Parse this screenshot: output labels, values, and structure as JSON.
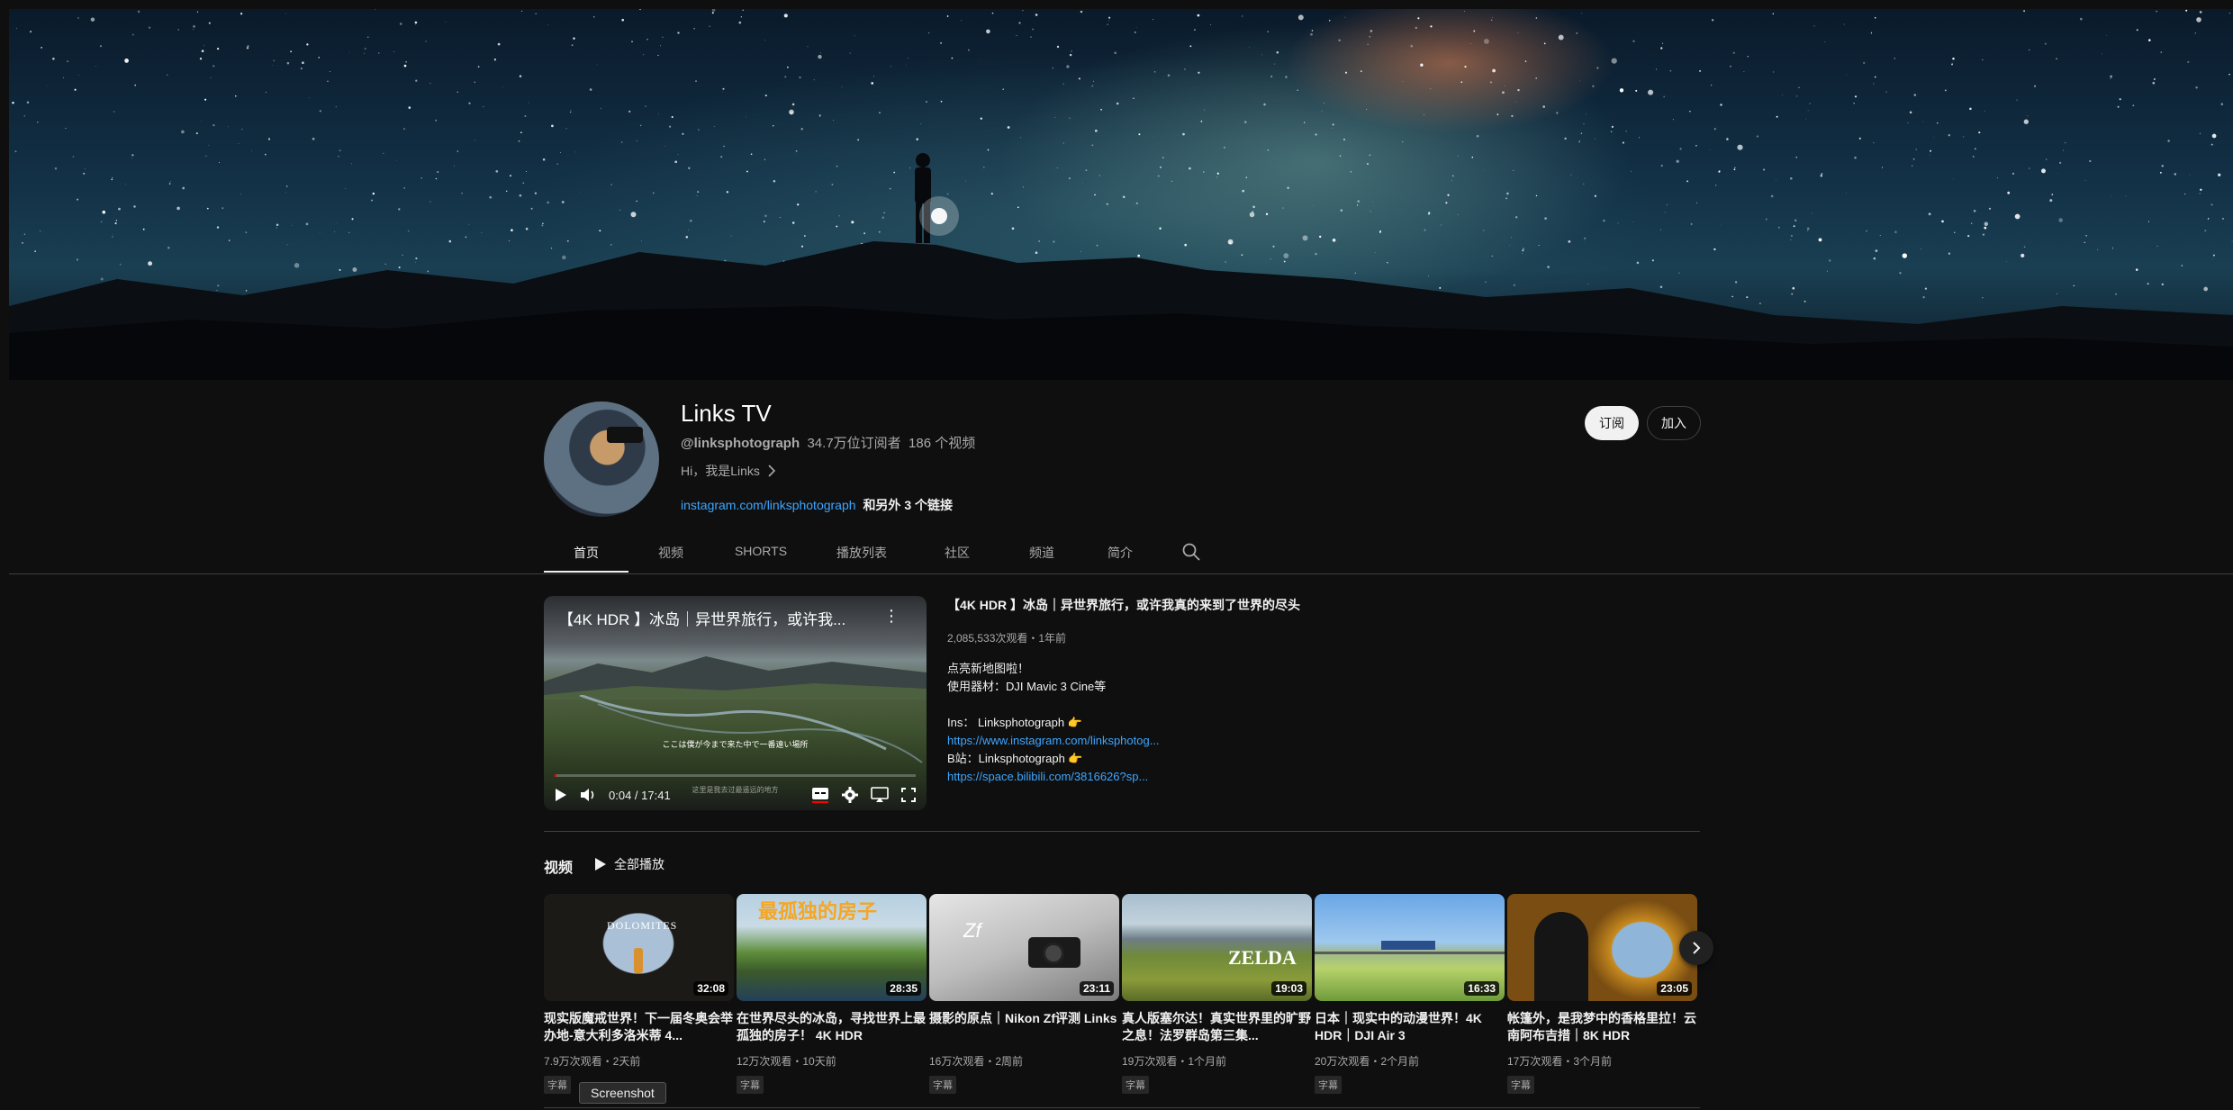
{
  "channel": {
    "name": "Links TV",
    "handle": "@linksphotograph",
    "subscribers": "34.7万位订阅者",
    "video_count": "186 个视频",
    "description": "Hi，我是Links",
    "link": "instagram.com/linksphotograph",
    "more_links": "和另外 3 个链接",
    "subscribe_label": "订阅",
    "join_label": "加入"
  },
  "tabs": [
    {
      "label": "首页"
    },
    {
      "label": "视频"
    },
    {
      "label": "SHORTS"
    },
    {
      "label": "播放列表"
    },
    {
      "label": "社区"
    },
    {
      "label": "频道"
    },
    {
      "label": "简介"
    }
  ],
  "featured": {
    "overlay_title": "【4K HDR 】冰岛｜异世界旅行，或许我...",
    "title": "【4K HDR 】冰岛｜异世界旅行，或许我真的来到了世界的尽头",
    "stats": "2,085,533次观看・1年前",
    "subtitle_line": "ここは僕が今まで来た中で一番遠い場所",
    "subtitle_line2": "这里是我去过最遥远的地方",
    "time": "0:04 / 17:41",
    "progress": 0.004,
    "desc": {
      "l1": "点亮新地图啦！",
      "l2": "使用器材：DJI Mavic 3 Cine等",
      "l3": "Ins： Linksphotograph 👉",
      "l4": "https://www.instagram.com/linksphotog...",
      "l5": "B站：Linksphotograph 👉",
      "l6": "https://space.bilibili.com/3816626?sp..."
    }
  },
  "shelf": {
    "title": "视频",
    "play_all": "全部播放",
    "videos": [
      {
        "title": "现实版魔戒世界！下一届冬奥会举办地-意大利多洛米蒂 4...",
        "duration": "32:08",
        "meta": "7.9万次观看・2天前",
        "badge": "字幕"
      },
      {
        "title": "在世界尽头的冰岛，寻找世界上最孤独的房子！ 4K HDR",
        "duration": "28:35",
        "meta": "12万次观看・10天前",
        "badge": "字幕"
      },
      {
        "title": "摄影的原点｜Nikon Zf评测 Links",
        "duration": "23:11",
        "meta": "16万次观看・2周前",
        "badge": "字幕"
      },
      {
        "title": "真人版塞尔达！真实世界里的旷野之息！法罗群岛第三集...",
        "duration": "19:03",
        "meta": "19万次观看・1个月前",
        "badge": "字幕"
      },
      {
        "title": "日本｜现实中的动漫世界！4K HDR｜DJI Air 3",
        "duration": "16:33",
        "meta": "20万次观看・2个月前",
        "badge": "字幕"
      },
      {
        "title": "帐篷外，是我梦中的香格里拉！云南阿布吉措｜8K HDR",
        "duration": "23:05",
        "meta": "17万次观看・3个月前",
        "badge": "字幕"
      }
    ]
  },
  "thumb_text": {
    "v1": "DOLOMITES",
    "v2": "最孤独的房子",
    "v3": "Zf",
    "v4": "ZELDA"
  },
  "overlay": {
    "screenshot_label": "Screenshot"
  },
  "colors": {
    "accent_link": "#3ea6ff",
    "background": "#0f0f0f",
    "progress": "#ff0000"
  }
}
